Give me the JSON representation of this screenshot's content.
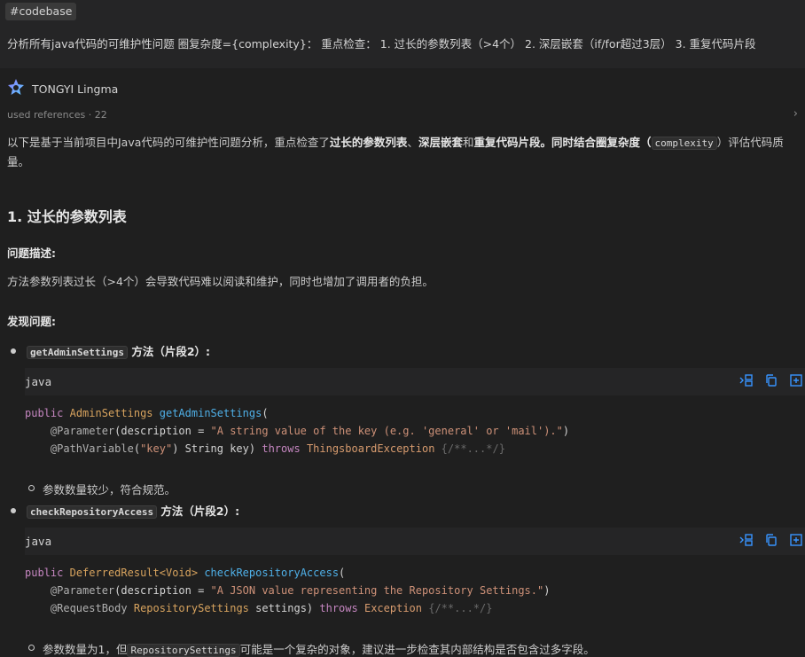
{
  "tag": "#codebase",
  "user_message": "分析所有java代码的可维护性问题 圈复杂度={complexity}： 重点检查： 1. 过长的参数列表（>4个） 2. 深层嵌套（if/for超过3层） 3. 重复代码片段",
  "agent": {
    "name": "TONGYI Lingma",
    "icon": "lingma-logo-icon"
  },
  "references": "used references · 22",
  "intro": {
    "p1": "以下是基于当前项目中Java代码的可维护性问题分析，重点检查了",
    "b1": "过长的参数列表",
    "p2": "、",
    "b2": "深层嵌套",
    "p3": "和",
    "b3": "重复代码片段",
    "p4": "。同时结合圈复杂度（",
    "code": "complexity",
    "p5": "）评估代码质量。"
  },
  "section1": {
    "title": "1. 过长的参数列表",
    "desc_label": "问题描述:",
    "desc": "方法参数列表过长（>4个）会导致代码难以阅读和维护，同时也增加了调用者的负担。",
    "found_label": "发现问题:"
  },
  "items": [
    {
      "method": "getAdminSettings",
      "suffix": " 方法（片段2）:",
      "lang": "java",
      "code": {
        "l1_kw": "public",
        "l1_type": "AdminSettings",
        "l1_fn": "getAdminSettings",
        "l1_p": "(",
        "l2_an": "@Parameter",
        "l2_a": "(description = ",
        "l2_str": "\"A string value of the key (e.g. 'general' or 'mail').\"",
        "l2_b": ")",
        "l3_an": "@PathVariable",
        "l3_a": "(",
        "l3_str": "\"key\"",
        "l3_b": ") String key) ",
        "l3_kw": "throws",
        "l3_ex": "ThingsboardException",
        "l3_cm": "{/**...*/}"
      },
      "note": "参数数量较少，符合规范。"
    },
    {
      "method": "checkRepositoryAccess",
      "suffix": " 方法（片段2）:",
      "lang": "java",
      "code": {
        "l1_kw": "public",
        "l1_type": "DeferredResult<Void>",
        "l1_fn": "checkRepositoryAccess",
        "l1_p": "(",
        "l2_an": "@Parameter",
        "l2_a": "(description = ",
        "l2_str": "\"A JSON value representing the Repository Settings.\"",
        "l2_b": ")",
        "l3_an": "@RequestBody",
        "l3_ty": "RepositorySettings",
        "l3_b": " settings) ",
        "l3_kw": "throws",
        "l3_ex": "Exception",
        "l3_cm": "{/**...*/}"
      },
      "note_a": "参数数量为1，但",
      "note_code": "RepositorySettings",
      "note_b": "可能是一个复杂的对象，建议进一步检查其内部结构是否包含过多字段。"
    }
  ],
  "toolbar": {
    "icons": [
      "insert-icon",
      "copy-icon",
      "new-file-icon"
    ]
  },
  "colors": {
    "background": "#1f1f1f",
    "keyword": "#c586c0",
    "type": "#d7a35e",
    "function": "#4fb0e8",
    "string": "#ce9178",
    "accent": "#3794ff"
  }
}
